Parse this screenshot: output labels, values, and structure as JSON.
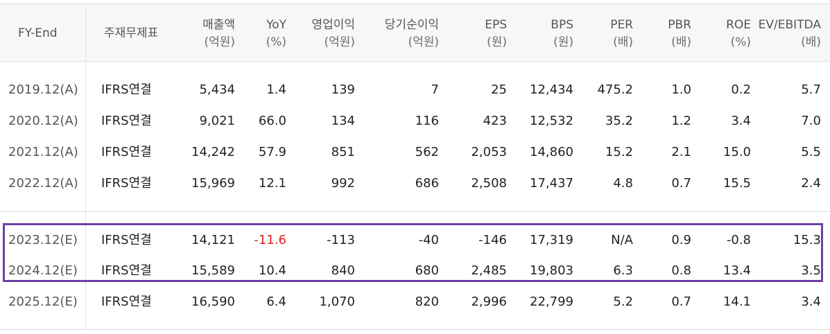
{
  "header": {
    "fy": "FY-End",
    "statement": "주재무제표",
    "columns": [
      {
        "label": "매출액",
        "unit": "(억원)"
      },
      {
        "label": "YoY",
        "unit": "(%)"
      },
      {
        "label": "영업이익",
        "unit": "(억원)"
      },
      {
        "label": "당기순이익",
        "unit": "(억원)"
      },
      {
        "label": "EPS",
        "unit": "(원)"
      },
      {
        "label": "BPS",
        "unit": "(원)"
      },
      {
        "label": "PER",
        "unit": "(배)"
      },
      {
        "label": "PBR",
        "unit": "(배)"
      },
      {
        "label": "ROE",
        "unit": "(%)"
      },
      {
        "label": "EV/EBITDA",
        "unit": "(배)"
      }
    ]
  },
  "rows": [
    {
      "fy": "2019.12(A)",
      "acc": "IFRS연결",
      "v": [
        "5,434",
        "1.4",
        "139",
        "7",
        "25",
        "12,434",
        "475.2",
        "1.0",
        "0.2",
        "5.7"
      ]
    },
    {
      "fy": "2020.12(A)",
      "acc": "IFRS연결",
      "v": [
        "9,021",
        "66.0",
        "134",
        "116",
        "423",
        "12,532",
        "35.2",
        "1.2",
        "3.4",
        "7.0"
      ]
    },
    {
      "fy": "2021.12(A)",
      "acc": "IFRS연결",
      "v": [
        "14,242",
        "57.9",
        "851",
        "562",
        "2,053",
        "14,860",
        "15.2",
        "2.1",
        "15.0",
        "5.5"
      ]
    },
    {
      "fy": "2022.12(A)",
      "acc": "IFRS연결",
      "v": [
        "15,969",
        "12.1",
        "992",
        "686",
        "2,508",
        "17,437",
        "4.8",
        "0.7",
        "15.5",
        "2.4"
      ]
    },
    {
      "fy": "2023.12(E)",
      "acc": "IFRS연결",
      "v": [
        "14,121",
        "-11.6",
        "-113",
        "-40",
        "-146",
        "17,319",
        "N/A",
        "0.9",
        "-0.8",
        "15.3"
      ]
    },
    {
      "fy": "2024.12(E)",
      "acc": "IFRS연결",
      "v": [
        "15,589",
        "10.4",
        "840",
        "680",
        "2,485",
        "19,803",
        "6.3",
        "0.8",
        "13.4",
        "3.5"
      ]
    },
    {
      "fy": "2025.12(E)",
      "acc": "IFRS연결",
      "v": [
        "16,590",
        "6.4",
        "1,070",
        "820",
        "2,996",
        "22,799",
        "5.2",
        "0.7",
        "14.1",
        "3.4"
      ]
    }
  ],
  "colors": {
    "negative_yoy": "#e02020",
    "highlight_border": "#6b3fa6"
  }
}
